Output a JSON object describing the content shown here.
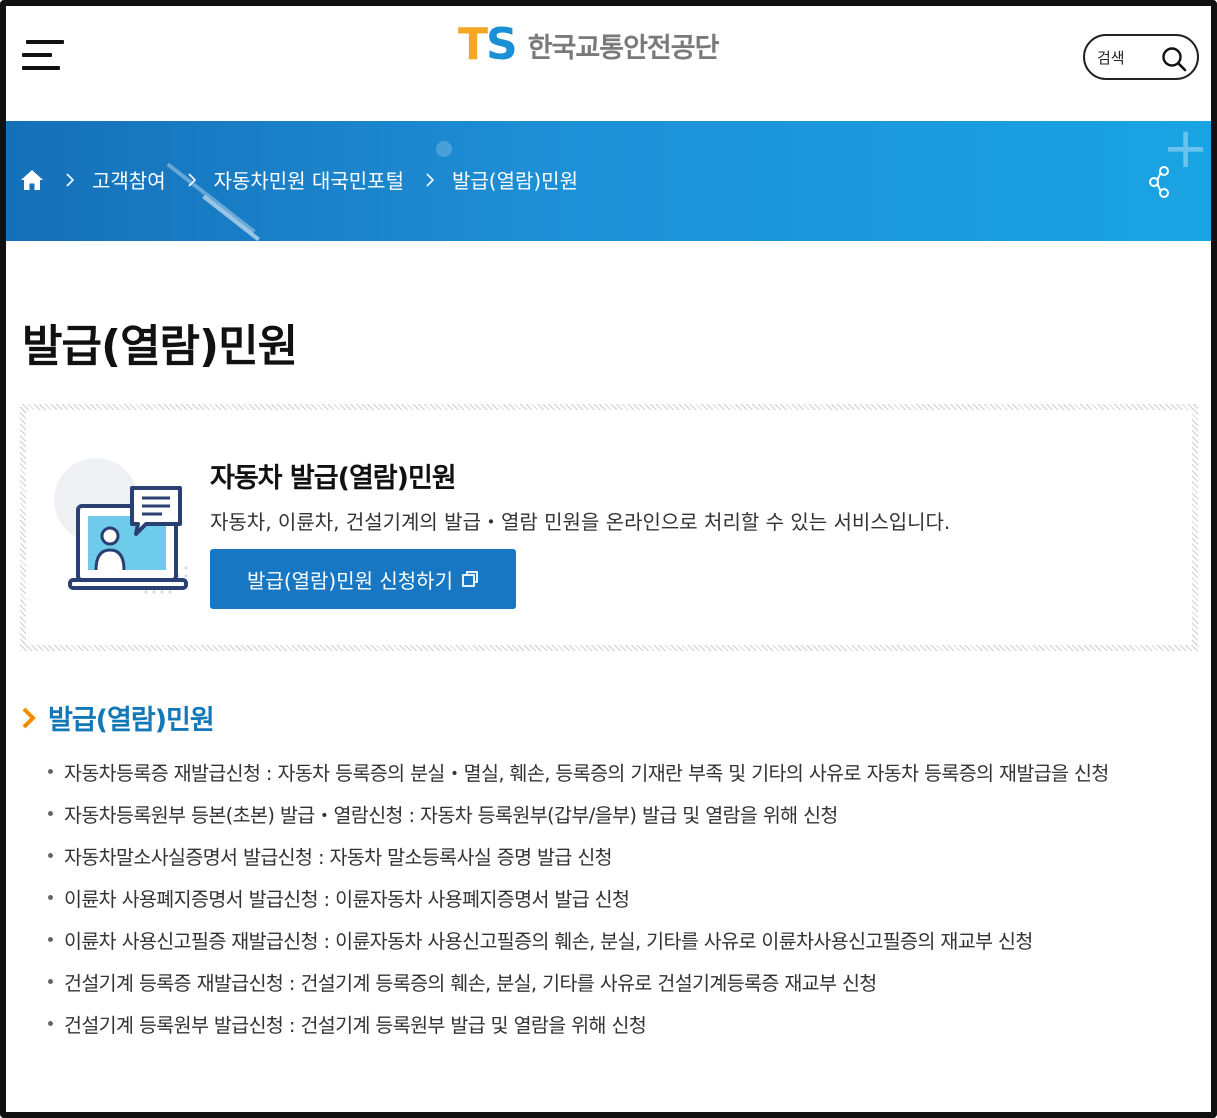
{
  "header": {
    "logo_mark_t": "T",
    "logo_mark_s": "S",
    "logo_text": "한국교통안전공단",
    "search_label": "검색"
  },
  "breadcrumb": {
    "items": [
      "고객참여",
      "자동차민원 대국민포털",
      "발급(열람)민원"
    ]
  },
  "page": {
    "title": "발급(열람)민원"
  },
  "service": {
    "title": "자동차 발급(열람)민원",
    "description": "자동차, 이륜차, 건설기계의 발급・열람 민원을 온라인으로 처리할 수 있는 서비스입니다.",
    "button_label": "발급(열람)민원 신청하기"
  },
  "section": {
    "title": "발급(열람)민원",
    "items": [
      "자동차등록증 재발급신청 : 자동차 등록증의 분실・멸실, 훼손, 등록증의 기재란 부족 및 기타의 사유로 자동차 등록증의 재발급을 신청",
      "자동차등록원부 등본(초본) 발급・열람신청 : 자동차 등록원부(갑부/을부) 발급 및 열람을 위해 신청",
      "자동차말소사실증명서 발급신청 : 자동차 말소등록사실 증명 발급 신청",
      "이륜차 사용폐지증명서 발급신청 : 이륜자동차 사용폐지증명서 발급 신청",
      "이륜차 사용신고필증 재발급신청 : 이륜자동차 사용신고필증의 훼손, 분실, 기타를 사유로 이륜차사용신고필증의 재교부 신청",
      "건설기계 등록증 재발급신청 : 건설기계 등록증의 훼손, 분실, 기타를 사유로 건설기계등록증 재교부 신청",
      "건설기계 등록원부 발급신청 : 건설기계 등록원부 발급 및 열람을 위해 신청"
    ]
  },
  "colors": {
    "brand_blue": "#1777c2",
    "banner_start": "#1570b8",
    "banner_end": "#19a4e4",
    "logo_orange": "#f5a623",
    "section_title": "#1478b8",
    "chevron_orange": "#f08c00"
  }
}
